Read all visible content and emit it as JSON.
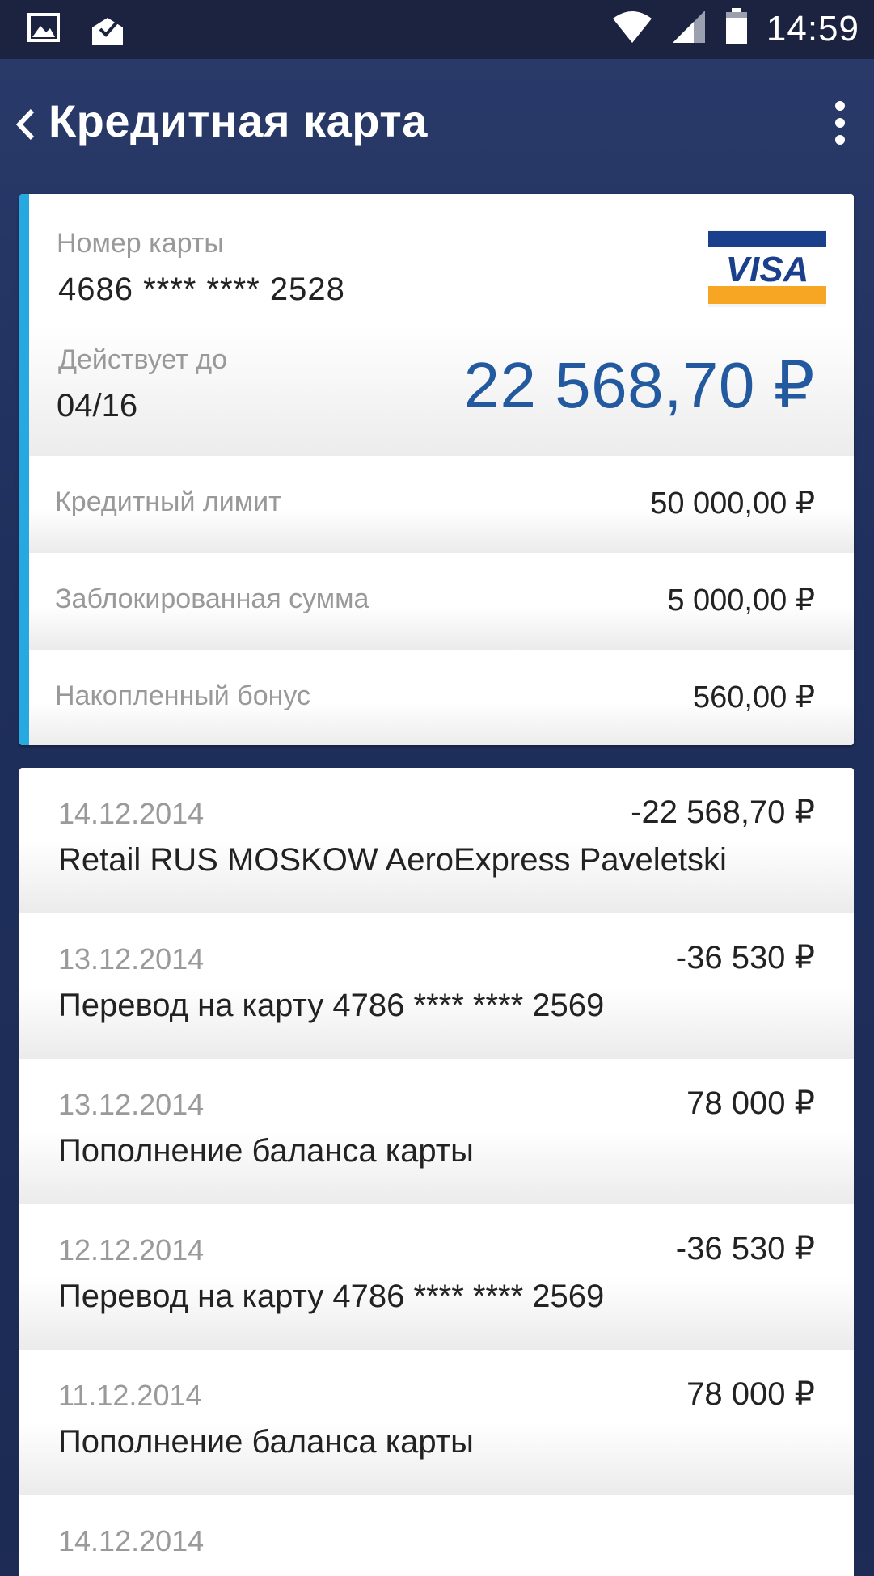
{
  "status_bar": {
    "time": "14:59",
    "icons": [
      "image-icon",
      "mail-check-icon",
      "wifi-icon",
      "signal-icon",
      "battery-icon"
    ]
  },
  "app_bar": {
    "title": "Кредитная карта"
  },
  "card": {
    "number_label": "Номер карты",
    "number": "4686 **** **** 2528",
    "valid_label": "Действует до",
    "valid_until": "04/16",
    "balance": "22 568,70 ₽",
    "brand": "VISA",
    "accent_color": "#26a9e0",
    "balance_color": "#23599e",
    "details": [
      {
        "label": "Кредитный лимит",
        "value": "50 000,00 ₽"
      },
      {
        "label": "Заблокированная сумма",
        "value": "5 000,00 ₽"
      },
      {
        "label": "Накопленный бонус",
        "value": "560,00 ₽"
      }
    ]
  },
  "transactions": [
    {
      "date": "14.12.2014",
      "amount": "-22 568,70 ₽",
      "description": "Retail RUS MOSKOW AeroExpress Paveletski"
    },
    {
      "date": "13.12.2014",
      "amount": "-36 530 ₽",
      "description": "Перевод на карту 4786 **** **** 2569"
    },
    {
      "date": "13.12.2014",
      "amount": "78 000 ₽",
      "description": "Пополнение баланса карты"
    },
    {
      "date": "12.12.2014",
      "amount": "-36 530 ₽",
      "description": "Перевод на карту 4786 **** **** 2569"
    },
    {
      "date": "11.12.2014",
      "amount": "78 000 ₽",
      "description": "Пополнение баланса карты"
    },
    {
      "date": "14.12.2014",
      "amount": "",
      "description": ""
    }
  ]
}
